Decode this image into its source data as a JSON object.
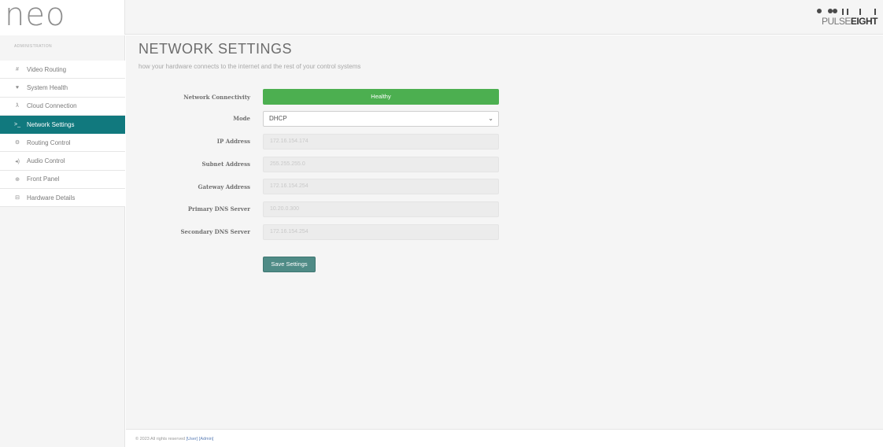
{
  "header": {
    "logo": "neo",
    "brand_bold": "EIGHT",
    "brand_thin": "PULSE"
  },
  "sidebar": {
    "heading": "ADMINISTRATION",
    "items": [
      {
        "label": "Video Routing",
        "icon": "#",
        "active": false
      },
      {
        "label": "System Health",
        "icon": "♥",
        "active": false
      },
      {
        "label": "Cloud Connection",
        "icon": "ƛ",
        "active": false
      },
      {
        "label": "Network Settings",
        "icon": ">_",
        "active": true
      },
      {
        "label": "Routing Control",
        "icon": "⚙",
        "active": false
      },
      {
        "label": "Audio Control",
        "icon": "◂)",
        "active": false
      },
      {
        "label": "Front Panel",
        "icon": "⊕",
        "active": false
      },
      {
        "label": "Hardware Details",
        "icon": "⊟",
        "active": false
      }
    ]
  },
  "main": {
    "title": "NETWORK SETTINGS",
    "subtitle": "how your hardware connects to the internet and the rest of your control systems",
    "connectivity": {
      "label": "Network Connectivity",
      "value": "Healthy",
      "color": "#4caf50"
    },
    "mode": {
      "label": "Mode",
      "value": "DHCP"
    },
    "ip": {
      "label": "IP Address",
      "value": "172.16.154.174"
    },
    "subnet": {
      "label": "Subnet Address",
      "value": "255.255.255.0"
    },
    "gateway": {
      "label": "Gateway Address",
      "value": "172.16.154.254"
    },
    "dns1": {
      "label": "Primary DNS Server",
      "value": "10.20.0.300"
    },
    "dns2": {
      "label": "Secondary DNS Server",
      "value": "172.16.154.254"
    },
    "save_label": "Save Settings"
  },
  "footer": {
    "text": "© 2023 All rights reserved",
    "user_link": "[User]",
    "admin_link": "[Admin]"
  },
  "colors": {
    "accent": "#11797e",
    "healthy": "#4caf50",
    "save_button": "#4f8b86"
  }
}
